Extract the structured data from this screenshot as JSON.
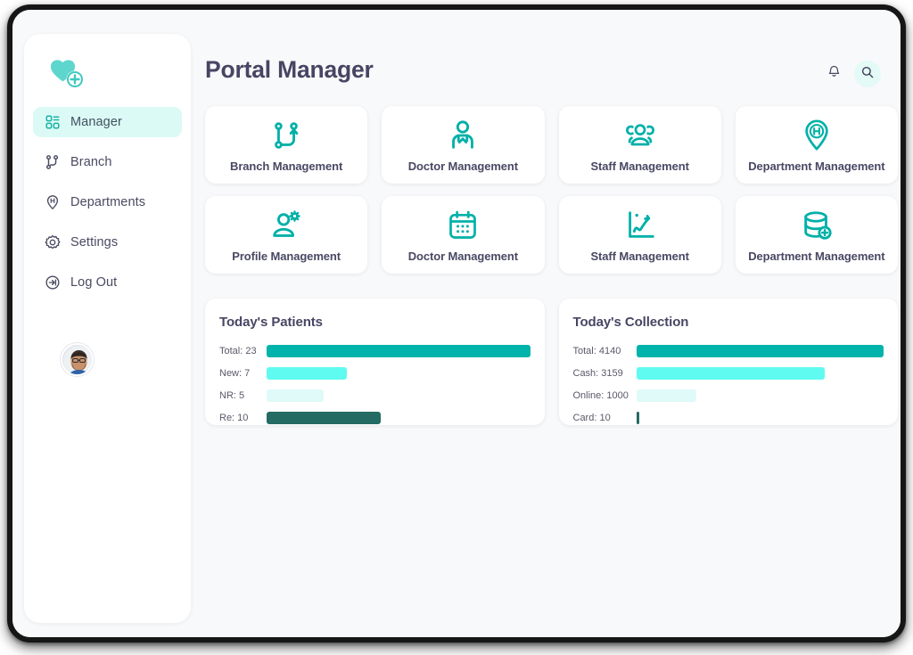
{
  "header": {
    "title": "Portal Manager",
    "notification_icon": "bell-icon",
    "search_icon": "search-icon"
  },
  "sidebar": {
    "logo_icon": "heart-plus-logo",
    "avatar_icon": "user-avatar",
    "items": [
      {
        "label": "Manager",
        "icon": "dashboard-grid-icon",
        "active": true
      },
      {
        "label": "Branch",
        "icon": "branch-icon",
        "active": false
      },
      {
        "label": "Departments",
        "icon": "location-pin-h-icon",
        "active": false
      },
      {
        "label": "Settings",
        "icon": "gear-icon",
        "active": false
      },
      {
        "label": "Log Out",
        "icon": "logout-icon",
        "active": false
      }
    ]
  },
  "tiles": [
    {
      "label": "Branch Management",
      "icon": "branch-network-icon"
    },
    {
      "label": "Doctor Management",
      "icon": "doctor-stethoscope-icon"
    },
    {
      "label": "Staff Management",
      "icon": "people-group-icon"
    },
    {
      "label": "Department Management",
      "icon": "hospital-pin-icon"
    },
    {
      "label": "Profile Management",
      "icon": "user-gear-icon"
    },
    {
      "label": "Doctor Management",
      "icon": "calendar-icon"
    },
    {
      "label": "Staff Management",
      "icon": "analytics-chart-icon"
    },
    {
      "label": "Department Management",
      "icon": "database-plus-icon"
    }
  ],
  "colors": {
    "accent": "#00b5ad",
    "bar_total": "#00b3ab",
    "bar_second": "#5ffbf1",
    "bar_third": "#dffaf8",
    "bar_fourth": "#236b63",
    "title": "#464563",
    "active_nav_bg": "#dcfaf5"
  },
  "chart_data": [
    {
      "type": "bar",
      "title": "Today's Patients",
      "orientation": "horizontal",
      "categories": [
        "Total",
        "New",
        "NR",
        "Re"
      ],
      "values": [
        23,
        7,
        5,
        10
      ],
      "labels": [
        "Total: 23",
        "New: 7",
        "NR: 5",
        "Re: 10"
      ],
      "max": 23,
      "colors": [
        "#00b3ab",
        "#5ffbf1",
        "#dffaf8",
        "#236b63"
      ],
      "xlabel": "",
      "ylabel": "",
      "grid": false,
      "legend": false
    },
    {
      "type": "bar",
      "title": "Today's Collection",
      "orientation": "horizontal",
      "categories": [
        "Total",
        "Cash",
        "Online",
        "Card"
      ],
      "values": [
        4140,
        3159,
        1000,
        10
      ],
      "labels": [
        "Total: 4140",
        "Cash: 3159",
        "Online: 1000",
        "Card: 10"
      ],
      "max": 4140,
      "colors": [
        "#00b3ab",
        "#5ffbf1",
        "#dffaf8",
        "#236b63"
      ],
      "xlabel": "",
      "ylabel": "",
      "grid": false,
      "legend": false
    }
  ]
}
